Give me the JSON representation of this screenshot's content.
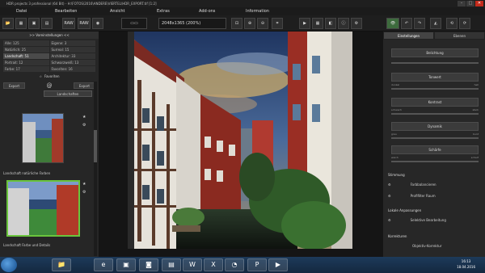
{
  "window": {
    "title": "HDR projects 3 professional (64 Bit) - H:\\FOTOS\\2016\\ANDERE\\VIERTEL\\HDR_EXPORT.tif [1:2]"
  },
  "menu": [
    "Datei",
    "Bearbeiten",
    "Ansicht",
    "Extras",
    "Add-ons",
    "Information"
  ],
  "toolbar": {
    "raw1": "RAW",
    "raw2": "RAW",
    "zoom": "2048x1365 (200%)"
  },
  "left": {
    "header": ">> Voreinstellungen <<",
    "stats": [
      "Alle: 125",
      "Eigene: 3",
      "Natürlich: 25",
      "Surreal: 15",
      "Landschaft: 51",
      "Architektur: 33",
      "Portrait: 12",
      "Schwarzweiß: 13",
      "Farbe: 17",
      "Favoriten: 16"
    ],
    "favorites_label": "Favoriten",
    "export1": "Export",
    "export2": "Export",
    "filter": "Landschaften",
    "caption1": "Landschaft natürliche Farben",
    "caption2": "Landschaft Farbe und Details"
  },
  "right": {
    "tab1": "Einstellungen",
    "tab2": "Ebenen",
    "bar_label": "Belichtung",
    "s1": "Tonwert",
    "s2": "Kontrast",
    "s3": "Dynamik",
    "s4": "Schärfe",
    "s5": "Struktur",
    "lbl_dunkel": "dunkel",
    "lbl_hell": "hell",
    "lbl_schwach": "schwach",
    "lbl_stark": "stark",
    "lbl_grau": "grau",
    "lbl_bunt": "bunt",
    "lbl_weich": "weich",
    "lbl_scharf": "scharf",
    "sec_stimmung": "Stimmung",
    "stimmung1": "Farbbalancieren",
    "stimmung2": "Profifilter Raum",
    "sec_lokal": "Lokale Anpassungen",
    "lokal1": "Selektive Bearbeitung",
    "sec_korrektur": "Korrekturen",
    "korrektur1": "Objektiv-Korrektur"
  },
  "taskbar": {
    "time": "16:13",
    "date": "18.04.2016"
  }
}
